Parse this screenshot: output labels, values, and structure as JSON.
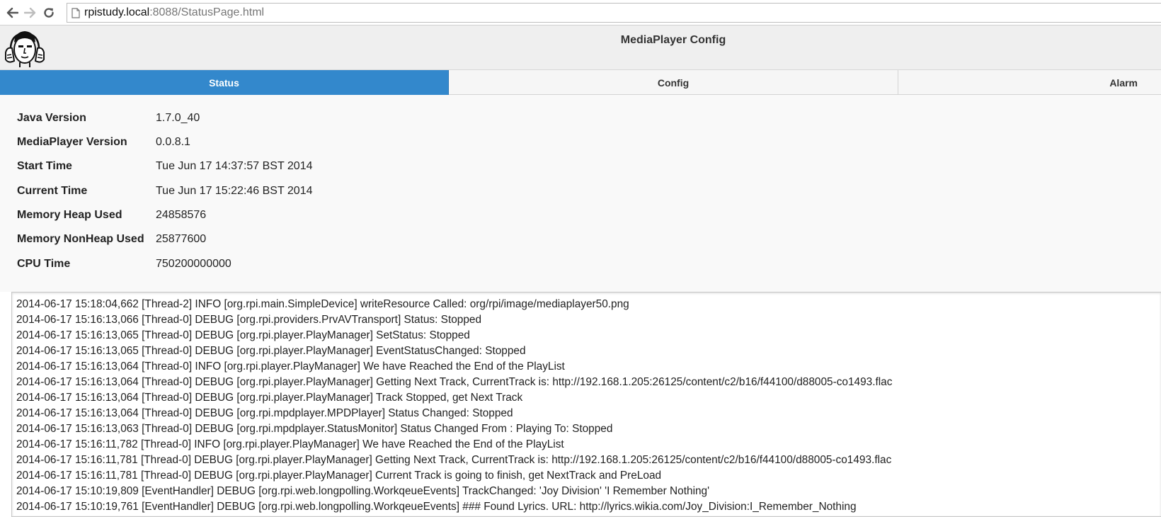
{
  "browser": {
    "url_host": "rpistudy.local",
    "url_rest": ":8088/StatusPage.html"
  },
  "header": {
    "title": "MediaPlayer Config"
  },
  "tabs": [
    {
      "label": "Status",
      "active": true
    },
    {
      "label": "Config",
      "active": false
    },
    {
      "label": "Alarm",
      "active": false
    }
  ],
  "status": {
    "rows": [
      {
        "label": "Java Version",
        "value": "1.7.0_40"
      },
      {
        "label": "MediaPlayer Version",
        "value": "0.0.8.1"
      },
      {
        "label": "Start Time",
        "value": "Tue Jun 17 14:37:57 BST 2014"
      },
      {
        "label": "Current Time",
        "value": "Tue Jun 17 15:22:46 BST 2014"
      },
      {
        "label": "Memory Heap Used",
        "value": "24858576"
      },
      {
        "label": "Memory NonHeap Used",
        "value": "25877600"
      },
      {
        "label": "CPU Time",
        "value": "750200000000"
      }
    ]
  },
  "log": {
    "lines": [
      "2014-06-17 15:18:04,662 [Thread-2] INFO  [org.rpi.main.SimpleDevice] writeResource Called: org/rpi/image/mediaplayer50.png",
      "2014-06-17 15:16:13,066 [Thread-0] DEBUG [org.rpi.providers.PrvAVTransport] Status: Stopped",
      "2014-06-17 15:16:13,065 [Thread-0] DEBUG [org.rpi.player.PlayManager] SetStatus: Stopped",
      "2014-06-17 15:16:13,065 [Thread-0] DEBUG [org.rpi.player.PlayManager] EventStatusChanged: Stopped",
      "2014-06-17 15:16:13,064 [Thread-0] INFO  [org.rpi.player.PlayManager] We have Reached the End of the PlayList",
      "2014-06-17 15:16:13,064 [Thread-0] DEBUG [org.rpi.player.PlayManager] Getting Next Track, CurrentTrack is: http://192.168.1.205:26125/content/c2/b16/f44100/d88005-co1493.flac",
      "2014-06-17 15:16:13,064 [Thread-0] DEBUG [org.rpi.player.PlayManager] Track Stopped, get Next Track",
      "2014-06-17 15:16:13,064 [Thread-0] DEBUG [org.rpi.mpdplayer.MPDPlayer] Status Changed: Stopped",
      "2014-06-17 15:16:13,063 [Thread-0] DEBUG [org.rpi.mpdplayer.StatusMonitor] Status Changed From : Playing To: Stopped",
      "2014-06-17 15:16:11,782 [Thread-0] INFO  [org.rpi.player.PlayManager] We have Reached the End of the PlayList",
      "2014-06-17 15:16:11,781 [Thread-0] DEBUG [org.rpi.player.PlayManager] Getting Next Track, CurrentTrack is: http://192.168.1.205:26125/content/c2/b16/f44100/d88005-co1493.flac",
      "2014-06-17 15:16:11,781 [Thread-0] DEBUG [org.rpi.player.PlayManager] Current Track is going to finish, get NextTrack and PreLoad",
      "2014-06-17 15:10:19,809 [EventHandler] DEBUG [org.rpi.web.longpolling.WorkqeueEvents] TrackChanged: 'Joy Division' 'I Remember Nothing'",
      "2014-06-17 15:10:19,761 [EventHandler] DEBUG [org.rpi.web.longpolling.WorkqeueEvents] ### Found Lyrics. URL: http://lyrics.wikia.com/Joy_Division:I_Remember_Nothing"
    ]
  },
  "icons": {
    "back": "arrow-left-icon",
    "forward": "arrow-right-icon",
    "reload": "reload-icon",
    "page": "page-icon",
    "logo": "headphones-face-logo"
  },
  "colors": {
    "active_tab": "#3388cc",
    "header_bg": "#efefef"
  }
}
